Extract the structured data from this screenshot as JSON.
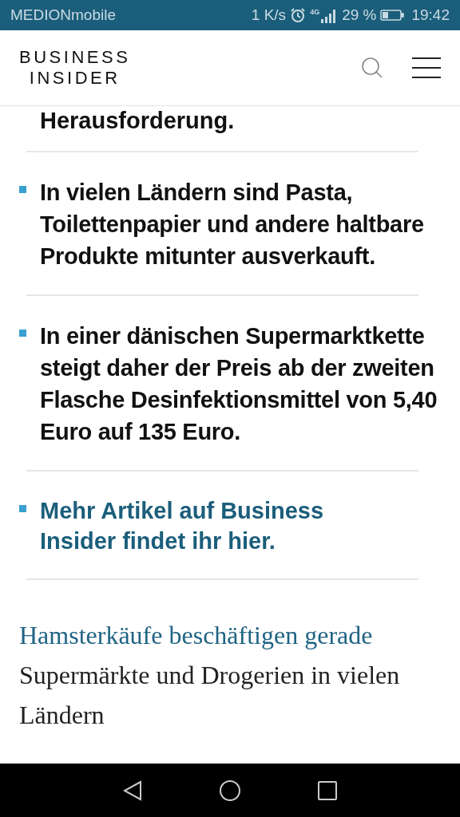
{
  "status_bar": {
    "carrier": "MEDIONmobile",
    "speed": "1 K/s",
    "network": "4G",
    "battery": "29 %",
    "time": "19:42"
  },
  "header": {
    "logo_lines": [
      "BUSINESS",
      "INSIDER"
    ]
  },
  "top_fragment": "Herausforderung.",
  "bullets": [
    {
      "kind": "text",
      "text": "In vielen Ländern sind Pasta, Toilettenpapier und andere haltbare Produkte mitunter ausverkauft."
    },
    {
      "kind": "text",
      "text": "In einer dänischen Supermarktkette steigt daher der Preis ab der zweiten Flasche Desinfektionsmittel von 5,40 Euro auf 135 Euro."
    },
    {
      "kind": "link",
      "text": "Mehr Artikel auf Business Insider findet ihr hier."
    }
  ],
  "paragraph": {
    "link": "Hamsterkäufe beschäftigen gerade",
    "text": "Supermärkte und Drogerien in vielen Ländern"
  }
}
